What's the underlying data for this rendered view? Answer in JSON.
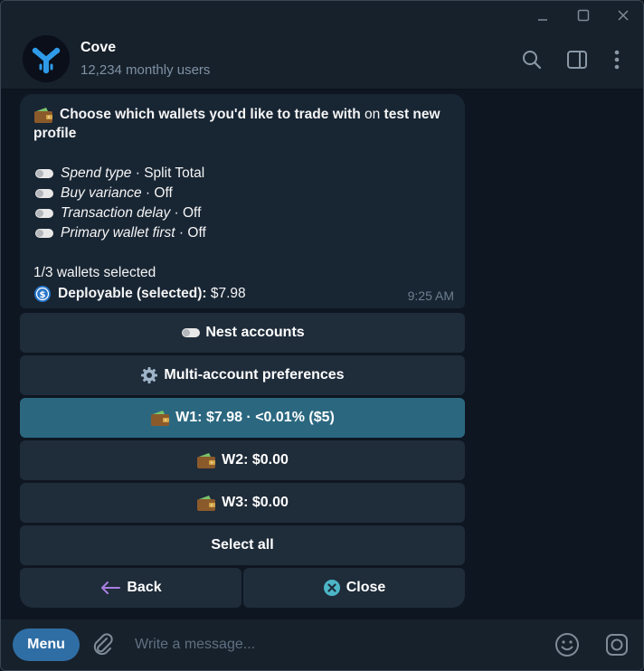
{
  "header": {
    "title": "Cove",
    "subtitle": "12,234 monthly users"
  },
  "message": {
    "title_bold_1": "Choose which wallets you'd like to trade with",
    "title_normal": " on ",
    "title_bold_2": "test new",
    "title_bold_3": "profile",
    "settings": [
      {
        "name": "Spend type",
        "sep": " · ",
        "value": "Split Total"
      },
      {
        "name": "Buy variance",
        "sep": " · ",
        "value": "Off"
      },
      {
        "name": "Transaction delay",
        "sep": " · ",
        "value": "Off"
      },
      {
        "name": "Primary wallet first",
        "sep": " · ",
        "value": "Off"
      }
    ],
    "wallets_selected": "1/3 wallets selected",
    "deployable_label": "Deployable (selected):",
    "deployable_value": " $7.98",
    "time": "9:25 AM"
  },
  "keyboard": {
    "nest_accounts": "Nest accounts",
    "multi_prefs": "Multi-account preferences",
    "w1": "W1: $7.98 · <0.01% ($5)",
    "w2": "W2: $0.00",
    "w3": "W3: $0.00",
    "select_all": "Select all",
    "back": "Back",
    "close": "Close"
  },
  "input": {
    "menu_label": "Menu",
    "placeholder": "Write a message..."
  },
  "colors": {
    "background": "#0e1621",
    "panel": "#17212b",
    "bubble": "#182533",
    "button": "#1f2c3a",
    "active_button": "#2b6880",
    "menu_button": "#2f6ea5"
  }
}
